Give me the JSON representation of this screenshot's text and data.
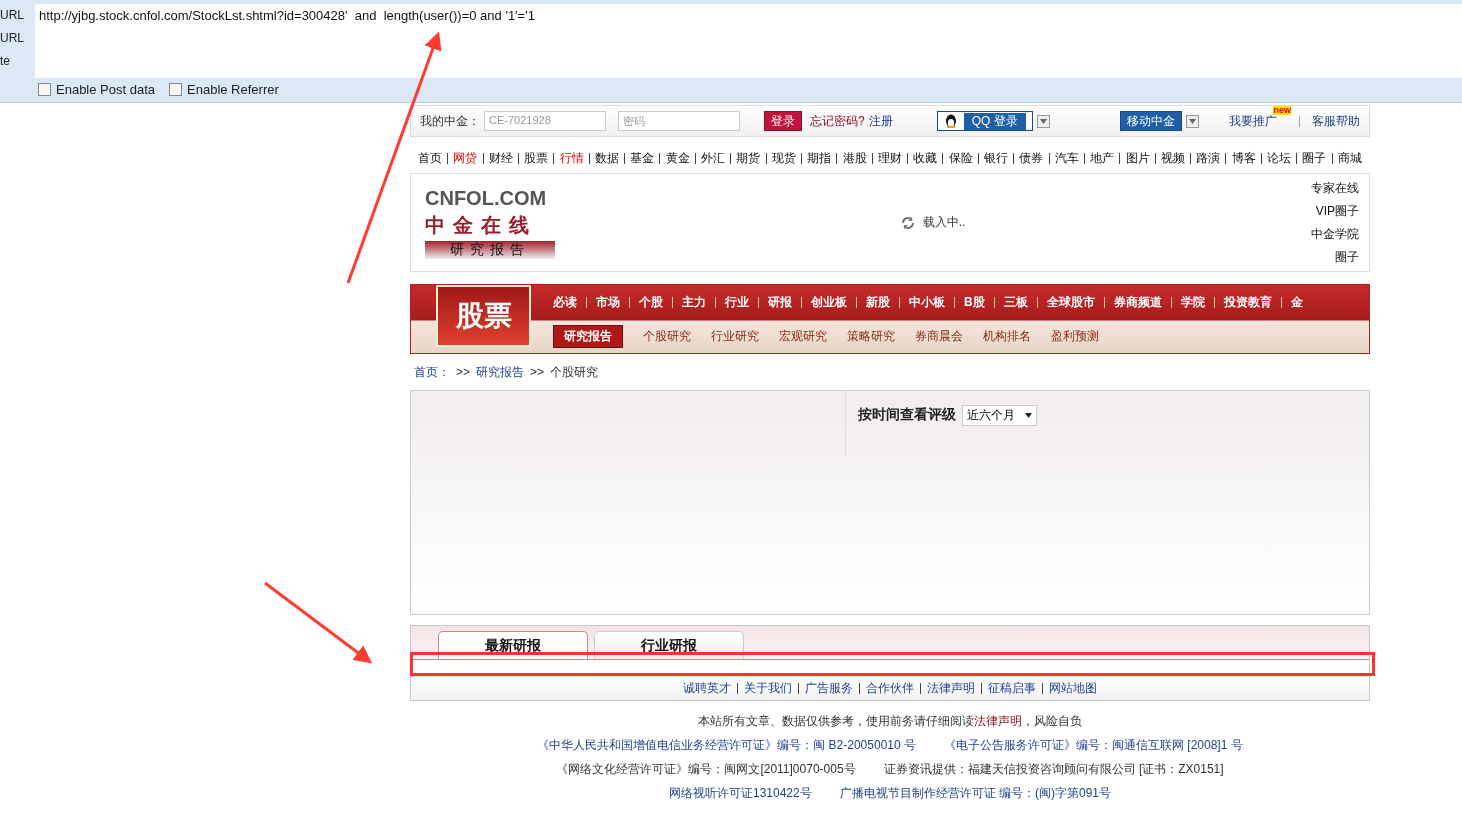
{
  "hackbar": {
    "labels": [
      "URL",
      "URL",
      "te"
    ],
    "url": "http://yjbg.stock.cnfol.com/StockLst.shtml?id=300428'  and  length(user())=0 and '1'='1",
    "options": [
      {
        "label": "Enable Post data",
        "checked": false
      },
      {
        "label": "Enable Referrer",
        "checked": false
      }
    ]
  },
  "login_bar": {
    "label": "我的中金：",
    "username": "CE-7021928",
    "password_placeholder": "密码",
    "login": "登录",
    "forgot": "忘记密码?",
    "register": "注册",
    "qq_login": "QQ 登录",
    "mobile": "移动中金",
    "promote": "我要推广",
    "promote_badge": "new",
    "help": "客服帮助"
  },
  "top_nav": [
    {
      "label": "首页",
      "highlighted": false
    },
    {
      "label": "网贷",
      "highlighted": true
    },
    {
      "label": "财经",
      "highlighted": false
    },
    {
      "label": "股票",
      "highlighted": false
    },
    {
      "label": "行情",
      "highlighted": true
    },
    {
      "label": "数据",
      "highlighted": false
    },
    {
      "label": "基金",
      "highlighted": false
    },
    {
      "label": "黄金",
      "highlighted": false
    },
    {
      "label": "外汇",
      "highlighted": false
    },
    {
      "label": "期货",
      "highlighted": false
    },
    {
      "label": "现货",
      "highlighted": false
    },
    {
      "label": "期指",
      "highlighted": false
    },
    {
      "label": "港股",
      "highlighted": false
    },
    {
      "label": "理财",
      "highlighted": false
    },
    {
      "label": "收藏",
      "highlighted": false
    },
    {
      "label": "保险",
      "highlighted": false
    },
    {
      "label": "银行",
      "highlighted": false
    },
    {
      "label": "债券",
      "highlighted": false
    },
    {
      "label": "汽车",
      "highlighted": false
    },
    {
      "label": "地产",
      "highlighted": false
    },
    {
      "label": "图片",
      "highlighted": false
    },
    {
      "label": "视频",
      "highlighted": false
    },
    {
      "label": "路演",
      "highlighted": false
    },
    {
      "label": "博客",
      "highlighted": false
    },
    {
      "label": "论坛",
      "highlighted": false
    },
    {
      "label": "圈子",
      "highlighted": false
    },
    {
      "label": "商城",
      "highlighted": false
    }
  ],
  "logo": {
    "site": "CNFOL.COM",
    "name": "中金在线",
    "section": "研究报告"
  },
  "loading": "载入中..",
  "side_links": [
    "专家在线",
    "VIP圈子",
    "中金学院",
    "圈子"
  ],
  "channel": {
    "title": "股票",
    "nav": [
      "必读",
      "市场",
      "个股",
      "主力",
      "行业",
      "研报",
      "创业板",
      "新股",
      "中小板",
      "B股",
      "三板",
      "全球股市",
      "券商频道",
      "学院",
      "投资教育",
      "金"
    ],
    "sub_nav": [
      {
        "label": "研究报告",
        "selected": true
      },
      {
        "label": "个股研究",
        "selected": false
      },
      {
        "label": "行业研究",
        "selected": false
      },
      {
        "label": "宏观研究",
        "selected": false
      },
      {
        "label": "策略研究",
        "selected": false
      },
      {
        "label": "券商晨会",
        "selected": false
      },
      {
        "label": "机构排名",
        "selected": false
      },
      {
        "label": "盈利预测",
        "selected": false
      }
    ]
  },
  "breadcrumb": [
    "首页：",
    ">>",
    "研究报告",
    ">>",
    "个股研究"
  ],
  "filter": {
    "label": "按时间查看评级",
    "value": "近六个月"
  },
  "tabs": [
    {
      "label": "最新研报",
      "selected": true
    },
    {
      "label": "行业研报",
      "selected": false
    }
  ],
  "footer_links": [
    "诚聘英才",
    "关于我们",
    "广告服务",
    "合作伙伴",
    "法律声明",
    "征稿启事",
    "网站地图"
  ],
  "notice": {
    "before": "本站所有文章、数据仅供参考，使用前务请仔细阅读",
    "link": "法律声明",
    "after": "，风险自负"
  },
  "license_lines": [
    {
      "kind": "link",
      "items": [
        "《中华人民共和国增值电信业务经营许可证》编号：闽 B2-20050010 号",
        "《电子公告服务许可证》编号：闽通信互联网 [2008]1 号"
      ]
    },
    {
      "kind": "text",
      "items": [
        "《网络文化经营许可证》编号：闽网文[2011]0070-005号",
        "证券资讯提供：福建天信投资咨询顾问有限公司 [证书：ZX0151]"
      ]
    },
    {
      "kind": "link",
      "items": [
        "网络视听许可证1310422号",
        "广播电视节目制作经营许可证 编号：(闽)字第091号"
      ]
    }
  ]
}
